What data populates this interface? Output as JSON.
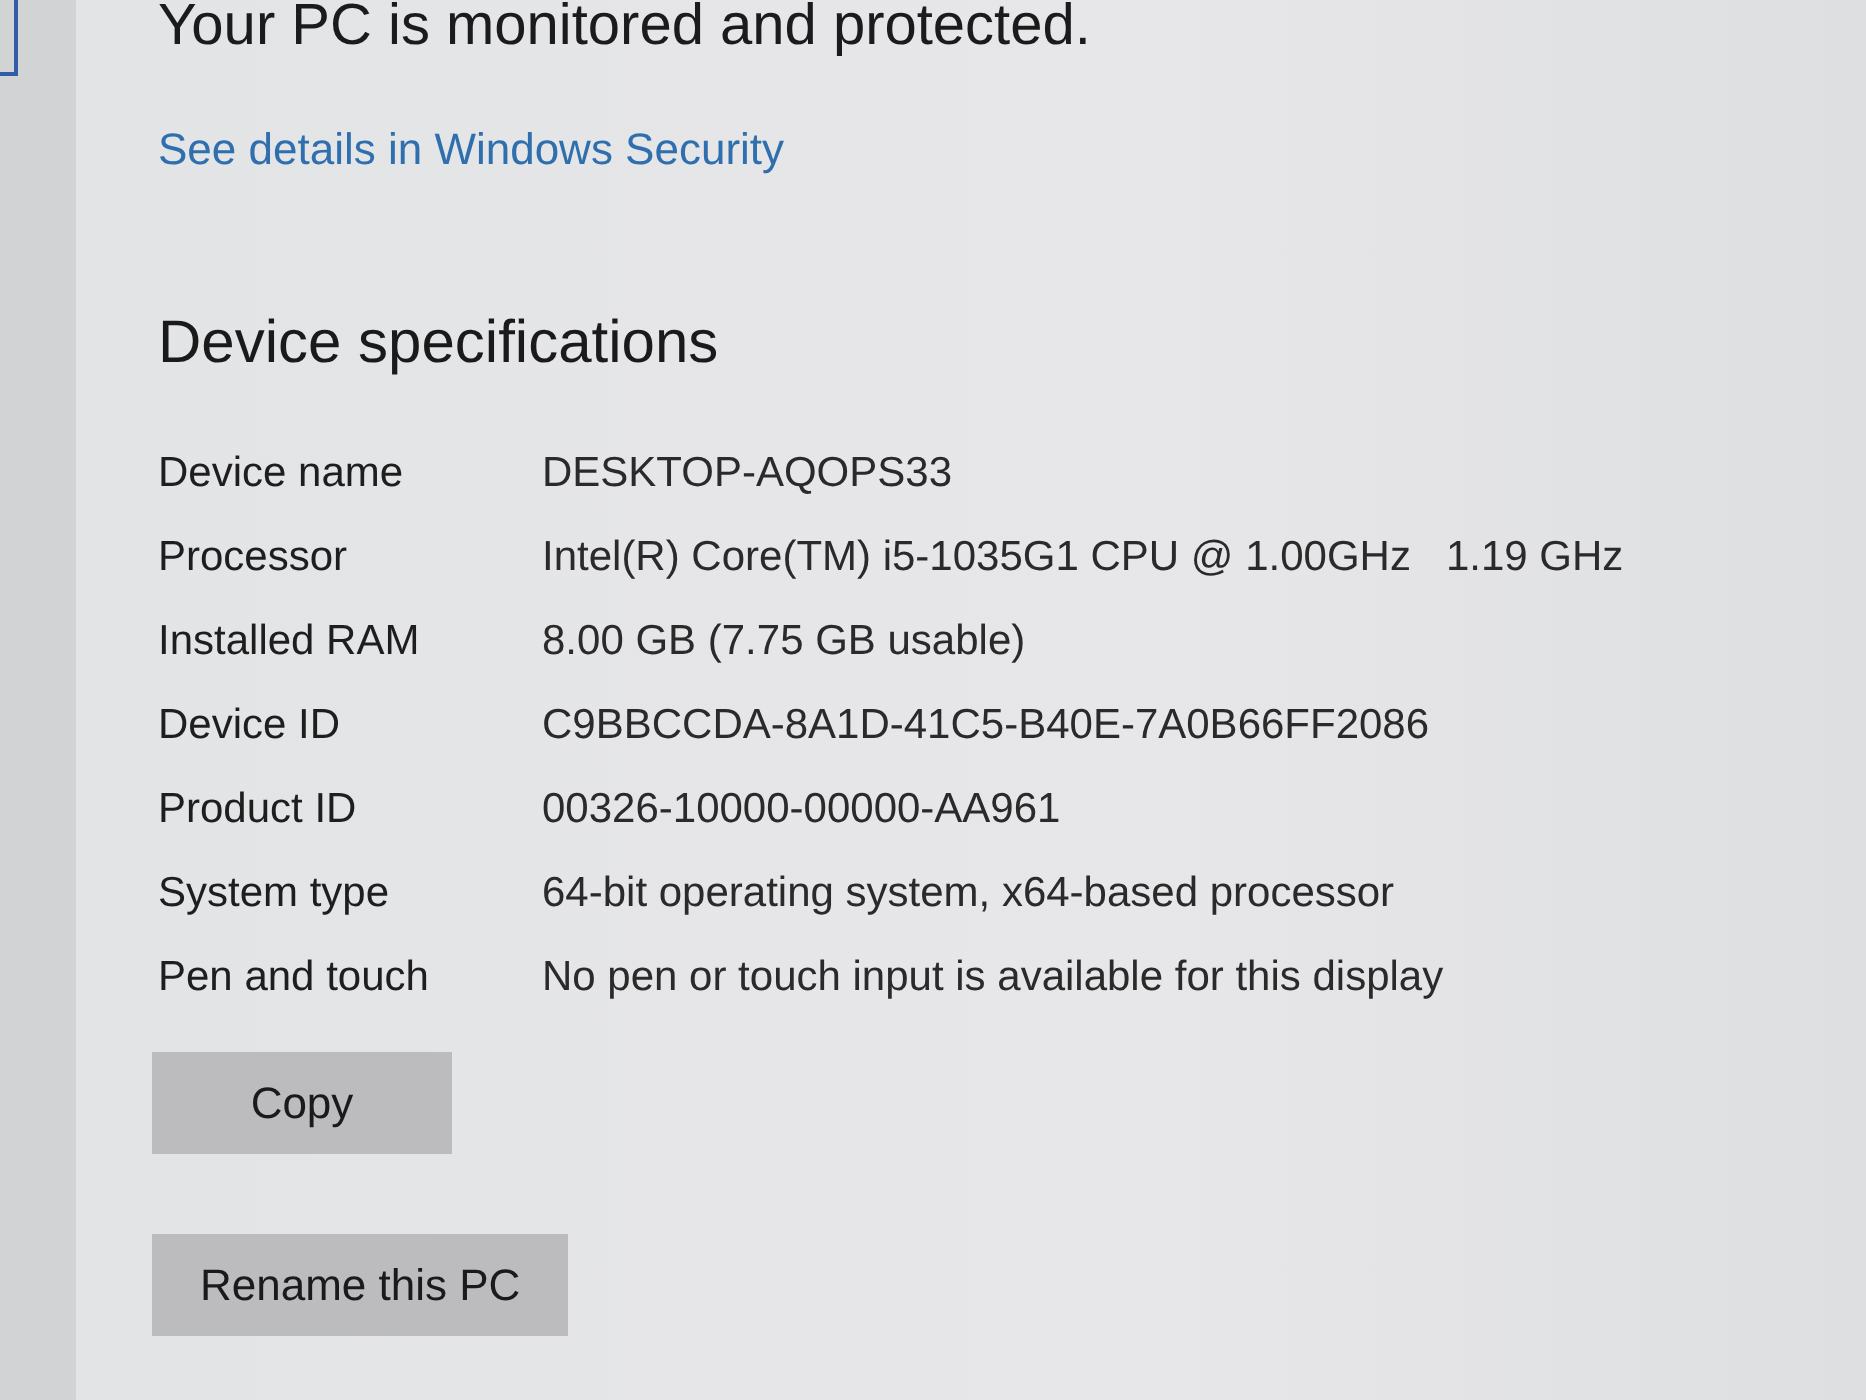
{
  "security": {
    "status": "Your PC is monitored and protected.",
    "link": "See details in Windows Security"
  },
  "specs": {
    "title": "Device specifications",
    "rows": [
      {
        "label": "Device name",
        "value": "DESKTOP-AQOPS33"
      },
      {
        "label": "Processor",
        "value": "Intel(R) Core(TM) i5-1035G1 CPU @ 1.00GHz   1.19 GHz"
      },
      {
        "label": "Installed RAM",
        "value": "8.00 GB (7.75 GB usable)"
      },
      {
        "label": "Device ID",
        "value": "C9BBCCDA-8A1D-41C5-B40E-7A0B66FF2086"
      },
      {
        "label": "Product ID",
        "value": "00326-10000-00000-AA961"
      },
      {
        "label": "System type",
        "value": "64-bit operating system, x64-based processor"
      },
      {
        "label": "Pen and touch",
        "value": "No pen or touch input is available for this display"
      }
    ]
  },
  "buttons": [
    "Copy",
    "Rename this PC"
  ]
}
